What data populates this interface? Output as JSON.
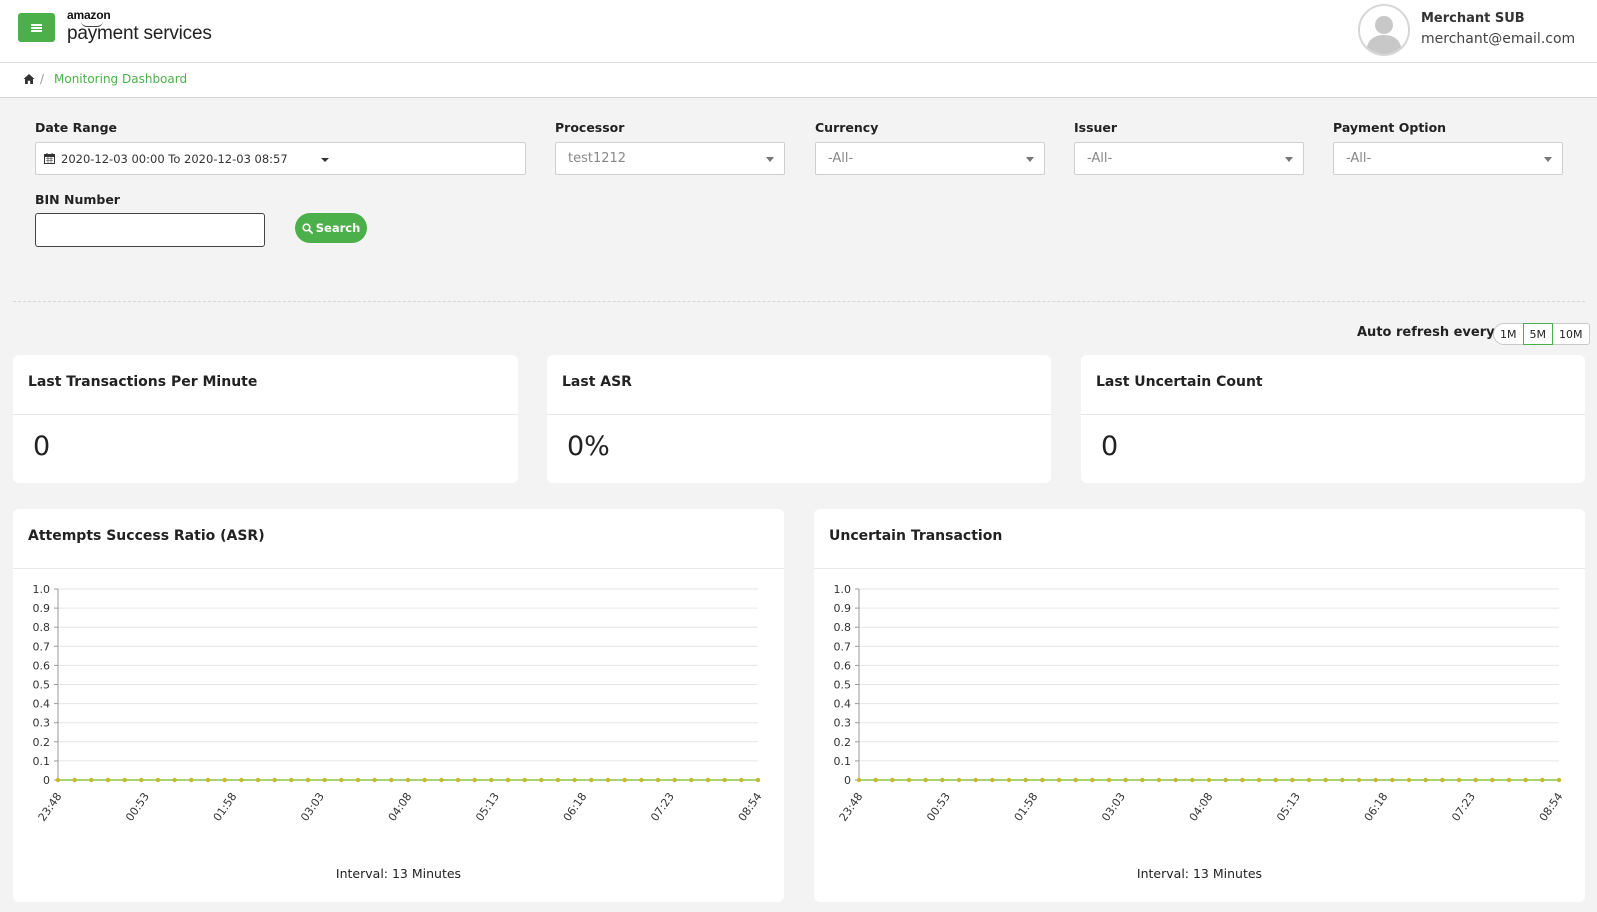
{
  "header": {
    "logo_top": "amazon",
    "logo_main": "payment services",
    "user_name": "Merchant SUB",
    "user_email": "merchant@email.com"
  },
  "breadcrumb": {
    "current": "Monitoring Dashboard",
    "separator": "/"
  },
  "filters": {
    "date_range": {
      "label": "Date Range",
      "value": "2020-12-03 00:00 To 2020-12-03 08:57"
    },
    "processor": {
      "label": "Processor",
      "value": "test1212"
    },
    "currency": {
      "label": "Currency",
      "value": "-All-"
    },
    "issuer": {
      "label": "Issuer",
      "value": "-All-"
    },
    "payment_option": {
      "label": "Payment Option",
      "value": "-All-"
    },
    "bin_number": {
      "label": "BIN Number",
      "value": ""
    },
    "search_label": "Search"
  },
  "auto_refresh": {
    "label": "Auto refresh every:",
    "options": [
      "1M",
      "5M",
      "10M"
    ],
    "selected": "5M"
  },
  "stats": [
    {
      "title": "Last Transactions Per Minute",
      "value": "0"
    },
    {
      "title": "Last ASR",
      "value": "0%"
    },
    {
      "title": "Last Uncertain Count",
      "value": "0"
    }
  ],
  "charts": [
    {
      "title": "Attempts Success Ratio (ASR)",
      "interval": "Interval: 13 Minutes"
    },
    {
      "title": "Uncertain Transaction",
      "interval": "Interval: 13 Minutes"
    }
  ],
  "colors": {
    "accent": "#4cb04a",
    "series_line": "#8bc34a",
    "series_point": "#c5b82b"
  },
  "chart_data": [
    {
      "type": "line",
      "title": "Attempts Success Ratio (ASR)",
      "ylim": [
        0,
        1.0
      ],
      "yticks": [
        "0",
        "0.1",
        "0.2",
        "0.3",
        "0.4",
        "0.5",
        "0.6",
        "0.7",
        "0.8",
        "0.9",
        "1.0"
      ],
      "xticks": [
        "23:48",
        "00:53",
        "01:58",
        "03:03",
        "04:08",
        "05:13",
        "06:18",
        "07:23",
        "08:54"
      ],
      "series": [
        {
          "values": [
            0,
            0,
            0,
            0,
            0,
            0,
            0,
            0,
            0,
            0,
            0,
            0,
            0,
            0,
            0,
            0,
            0,
            0,
            0,
            0,
            0,
            0,
            0,
            0,
            0,
            0,
            0,
            0,
            0,
            0,
            0,
            0,
            0,
            0,
            0,
            0,
            0,
            0,
            0,
            0,
            0,
            0,
            0
          ]
        }
      ]
    },
    {
      "type": "line",
      "title": "Uncertain Transaction",
      "ylim": [
        0,
        1.0
      ],
      "yticks": [
        "0",
        "0.1",
        "0.2",
        "0.3",
        "0.4",
        "0.5",
        "0.6",
        "0.7",
        "0.8",
        "0.9",
        "1.0"
      ],
      "xticks": [
        "23:48",
        "00:53",
        "01:58",
        "03:03",
        "04:08",
        "05:13",
        "06:18",
        "07:23",
        "08:54"
      ],
      "series": [
        {
          "values": [
            0,
            0,
            0,
            0,
            0,
            0,
            0,
            0,
            0,
            0,
            0,
            0,
            0,
            0,
            0,
            0,
            0,
            0,
            0,
            0,
            0,
            0,
            0,
            0,
            0,
            0,
            0,
            0,
            0,
            0,
            0,
            0,
            0,
            0,
            0,
            0,
            0,
            0,
            0,
            0,
            0,
            0,
            0
          ]
        }
      ]
    }
  ]
}
